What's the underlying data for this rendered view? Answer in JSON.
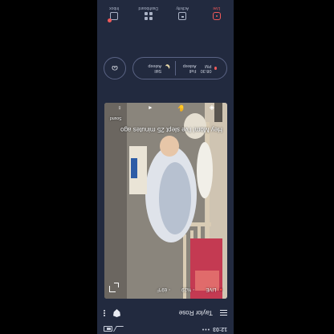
{
  "status_bar": {
    "time": "12:03",
    "dots": "•••"
  },
  "header": {
    "baby_name": "Taylor Rose"
  },
  "video": {
    "temperature": "69°F",
    "humidity": "%29",
    "live_label": "LIVE",
    "caption": "Hey Mom! I've slept 25 minutes ago",
    "sub_left": "",
    "sub_right": "Sound"
  },
  "status_pill": {
    "left_label": "Fell Asleep",
    "left_value": "08:30 PM",
    "right_label": "Still Asleep"
  },
  "nav": [
    {
      "label": "Live",
      "active": true
    },
    {
      "label": "Activity",
      "active": false
    },
    {
      "label": "Dashboard",
      "active": false
    },
    {
      "label": "Inbox",
      "active": false
    }
  ],
  "colors": {
    "background": "#222a3f",
    "accent": "#f05a5a",
    "outline": "#5a6384"
  }
}
